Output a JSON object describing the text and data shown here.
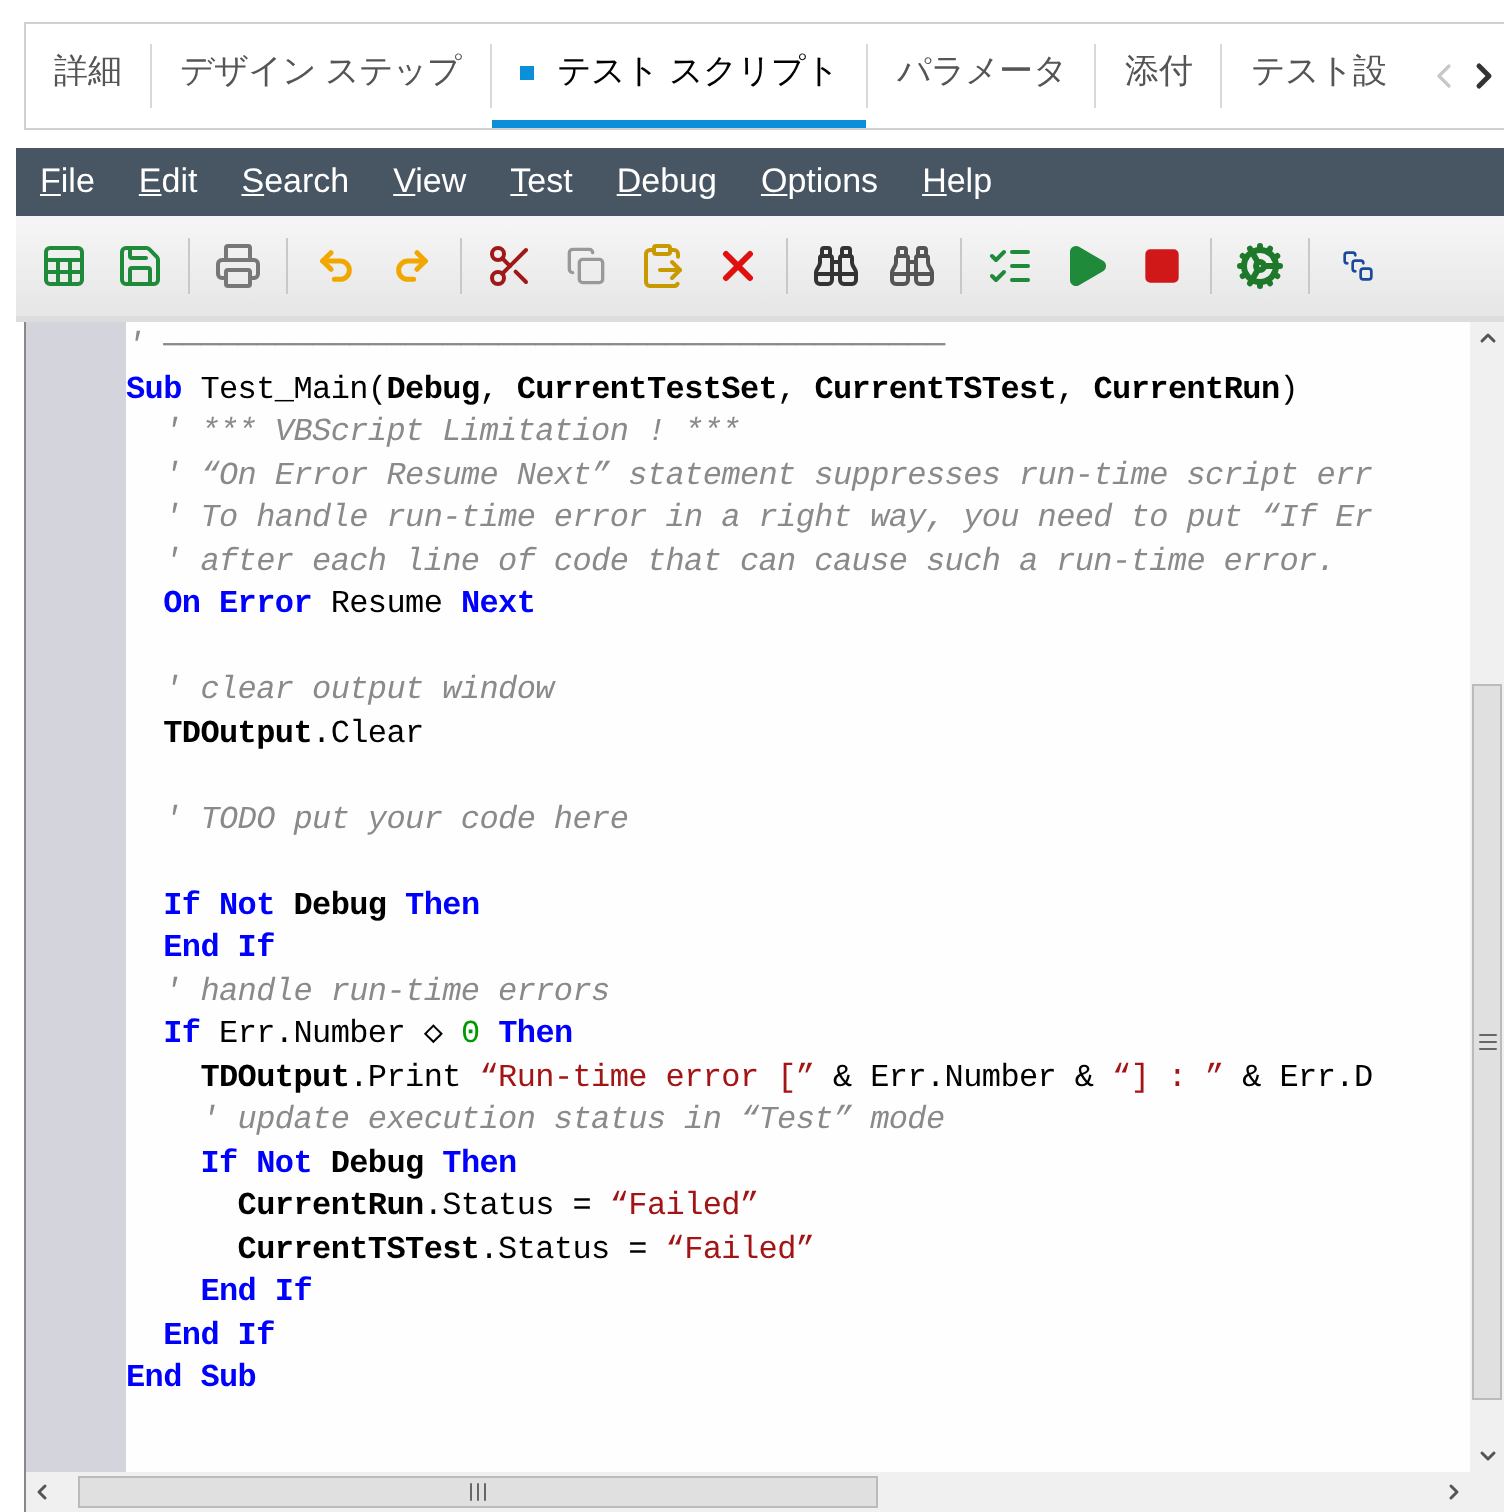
{
  "tabs": [
    {
      "label": "詳細",
      "selected": false
    },
    {
      "label": "デザイン ステップ",
      "selected": false
    },
    {
      "label": "テスト スクリプト",
      "selected": true
    },
    {
      "label": "パラメータ",
      "selected": false
    },
    {
      "label": "添付",
      "selected": false
    },
    {
      "label": "テスト設",
      "selected": false
    }
  ],
  "menu": [
    "File",
    "Edit",
    "Search",
    "View",
    "Test",
    "Debug",
    "Options",
    "Help"
  ],
  "editor": {
    "lines": [
      {
        "kind": "code",
        "tokens": [
          {
            "kind": "comment",
            "text": "' ──────────────────────────────────────────"
          }
        ]
      },
      {
        "kind": "code",
        "tokens": [
          {
            "kind": "keyword",
            "text": "Sub"
          },
          {
            "kind": "plain",
            "text": " Test_Main("
          },
          {
            "kind": "ident",
            "text": "Debug"
          },
          {
            "kind": "plain",
            "text": ", "
          },
          {
            "kind": "ident",
            "text": "CurrentTestSet"
          },
          {
            "kind": "plain",
            "text": ", "
          },
          {
            "kind": "ident",
            "text": "CurrentTSTest"
          },
          {
            "kind": "plain",
            "text": ", "
          },
          {
            "kind": "ident",
            "text": "CurrentRun"
          },
          {
            "kind": "plain",
            "text": ")"
          }
        ]
      },
      {
        "kind": "code",
        "tokens": [
          {
            "kind": "comment",
            "text": "  ' *** VBScript Limitation ! ***"
          }
        ]
      },
      {
        "kind": "code",
        "tokens": [
          {
            "kind": "comment",
            "text": "  ' “On Error Resume Next” statement suppresses run-time script err"
          }
        ]
      },
      {
        "kind": "code",
        "tokens": [
          {
            "kind": "comment",
            "text": "  ' To handle run-time error in a right way, you need to put “If Er"
          }
        ]
      },
      {
        "kind": "code",
        "tokens": [
          {
            "kind": "comment",
            "text": "  ' after each line of code that can cause such a run-time error."
          }
        ]
      },
      {
        "kind": "code",
        "tokens": [
          {
            "kind": "keyword",
            "text": "  On Error"
          },
          {
            "kind": "plain",
            "text": " Resume "
          },
          {
            "kind": "keyword",
            "text": "Next"
          }
        ]
      },
      {
        "kind": "blank"
      },
      {
        "kind": "code",
        "tokens": [
          {
            "kind": "comment",
            "text": "  ' clear output window"
          }
        ]
      },
      {
        "kind": "code",
        "tokens": [
          {
            "kind": "ident",
            "text": "  TDOutput"
          },
          {
            "kind": "plain",
            "text": ".Clear"
          }
        ]
      },
      {
        "kind": "blank"
      },
      {
        "kind": "code",
        "tokens": [
          {
            "kind": "comment",
            "text": "  ' TODO put your code here"
          }
        ]
      },
      {
        "kind": "blank"
      },
      {
        "kind": "code",
        "tokens": [
          {
            "kind": "keyword",
            "text": "  If Not"
          },
          {
            "kind": "ident",
            "text": " Debug"
          },
          {
            "kind": "keyword",
            "text": " Then"
          }
        ]
      },
      {
        "kind": "code",
        "tokens": [
          {
            "kind": "keyword",
            "text": "  End If"
          }
        ]
      },
      {
        "kind": "code",
        "tokens": [
          {
            "kind": "comment",
            "text": "  ' handle run-time errors"
          }
        ]
      },
      {
        "kind": "code",
        "tokens": [
          {
            "kind": "keyword",
            "text": "  If"
          },
          {
            "kind": "plain",
            "text": " Err.Number ◇ "
          },
          {
            "kind": "number",
            "text": "0"
          },
          {
            "kind": "keyword",
            "text": " Then"
          }
        ]
      },
      {
        "kind": "code",
        "tokens": [
          {
            "kind": "ident",
            "text": "    TDOutput"
          },
          {
            "kind": "plain",
            "text": ".Print "
          },
          {
            "kind": "string",
            "text": "“Run-time error [”"
          },
          {
            "kind": "plain",
            "text": " & Err.Number & "
          },
          {
            "kind": "string",
            "text": "“] : ”"
          },
          {
            "kind": "plain",
            "text": " & Err.D"
          }
        ]
      },
      {
        "kind": "code",
        "tokens": [
          {
            "kind": "comment",
            "text": "    ' update execution status in “Test” mode"
          }
        ]
      },
      {
        "kind": "code",
        "tokens": [
          {
            "kind": "keyword",
            "text": "    If Not"
          },
          {
            "kind": "ident",
            "text": " Debug"
          },
          {
            "kind": "keyword",
            "text": " Then"
          }
        ]
      },
      {
        "kind": "code",
        "tokens": [
          {
            "kind": "ident",
            "text": "      CurrentRun"
          },
          {
            "kind": "plain",
            "text": ".Status = "
          },
          {
            "kind": "string",
            "text": "“Failed”"
          }
        ]
      },
      {
        "kind": "code",
        "tokens": [
          {
            "kind": "ident",
            "text": "      CurrentTSTest"
          },
          {
            "kind": "plain",
            "text": ".Status = "
          },
          {
            "kind": "string",
            "text": "“Failed”"
          }
        ]
      },
      {
        "kind": "code",
        "tokens": [
          {
            "kind": "keyword",
            "text": "    End If"
          }
        ]
      },
      {
        "kind": "code",
        "tokens": [
          {
            "kind": "keyword",
            "text": "  End If"
          }
        ]
      },
      {
        "kind": "code",
        "tokens": [
          {
            "kind": "keyword",
            "text": "End Sub"
          }
        ]
      }
    ]
  }
}
